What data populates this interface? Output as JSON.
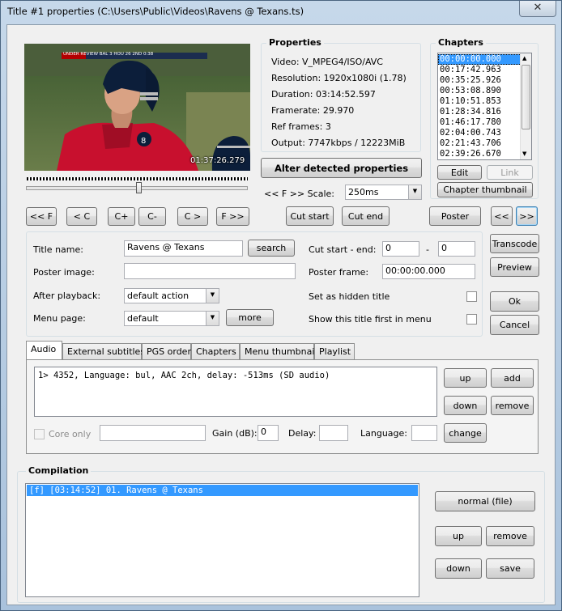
{
  "window": {
    "title": "Title #1 properties (C:\\Users\\Public\\Videos\\Ravens @ Texans.ts)",
    "close_glyph": "✕"
  },
  "video": {
    "timestamp": "01:37:26.279",
    "scoreboard": "UNDER REVIEW  BAL 3  HOU 26  2ND  0:38",
    "seek_fraction": 0.51
  },
  "nav": {
    "prev_file": "<< F",
    "prev_chapter": "< C",
    "c_plus": "C+",
    "c_minus": "C-",
    "next_chapter": "C >",
    "next_file": "F >>",
    "cut_start": "Cut start",
    "cut_end": "Cut end",
    "poster": "Poster",
    "poster_prev": "<<",
    "poster_next": ">>"
  },
  "properties": {
    "heading": "Properties",
    "lines": [
      "Video: V_MPEG4/ISO/AVC",
      "Resolution: 1920x1080i (1.78)",
      "Duration: 03:14:52.597",
      "Framerate: 29.970",
      "Ref frames: 3",
      "Output: 7747kbps / 12223MiB"
    ],
    "alter_button": "Alter detected properties",
    "scale_label": "<< F >> Scale:",
    "scale_value": "250ms"
  },
  "chapters": {
    "heading": "Chapters",
    "items": [
      "00:00:00.000",
      "00:17:42.963",
      "00:35:25.926",
      "00:53:08.890",
      "01:10:51.853",
      "01:28:34.816",
      "01:46:17.780",
      "02:04:00.743",
      "02:21:43.706",
      "02:39:26.670"
    ],
    "selected_index": 0,
    "edit": "Edit",
    "link": "Link",
    "thumbnail": "Chapter thumbnail"
  },
  "title_form": {
    "title_name_label": "Title name:",
    "title_name_value": "Ravens @ Texans",
    "search": "search",
    "poster_image_label": "Poster image:",
    "poster_image_value": "",
    "after_playback_label": "After playback:",
    "after_playback_value": "default action",
    "menu_page_label": "Menu page:",
    "menu_page_value": "default",
    "more": "more",
    "cut_label": "Cut start - end:",
    "cut_start_value": "0",
    "cut_dash": "-",
    "cut_end_value": "0",
    "poster_frame_label": "Poster frame:",
    "poster_frame_value": "00:00:00.000",
    "hidden_label": "Set as hidden title",
    "first_label": "Show this title first in menu"
  },
  "side_buttons": {
    "transcode": "Transcode",
    "preview": "Preview",
    "ok": "Ok",
    "cancel": "Cancel"
  },
  "tabs": [
    "Audio",
    "External subtitles",
    "PGS order",
    "Chapters",
    "Menu thumbnails",
    "Playlist"
  ],
  "audio": {
    "tracks": [
      "1> 4352, Language: bul, AAC 2ch, delay: -513ms (SD audio)"
    ],
    "up": "up",
    "add": "add",
    "down": "down",
    "remove": "remove",
    "core_only": "Core only",
    "gain_label": "Gain (dB):",
    "gain_value": "0",
    "delay_label": "Delay:",
    "delay_value": "",
    "language_label": "Language:",
    "language_value": "",
    "change": "change"
  },
  "compilation": {
    "heading": "Compilation",
    "items": [
      "[f] [03:14:52] 01. Ravens @ Texans"
    ],
    "normal": "normal (file)",
    "up": "up",
    "remove": "remove",
    "down": "down",
    "save": "save"
  },
  "colors": {
    "selection": "#3399ff",
    "dialog_bg": "#f0f0f0",
    "frame": "#b9cfe5"
  }
}
